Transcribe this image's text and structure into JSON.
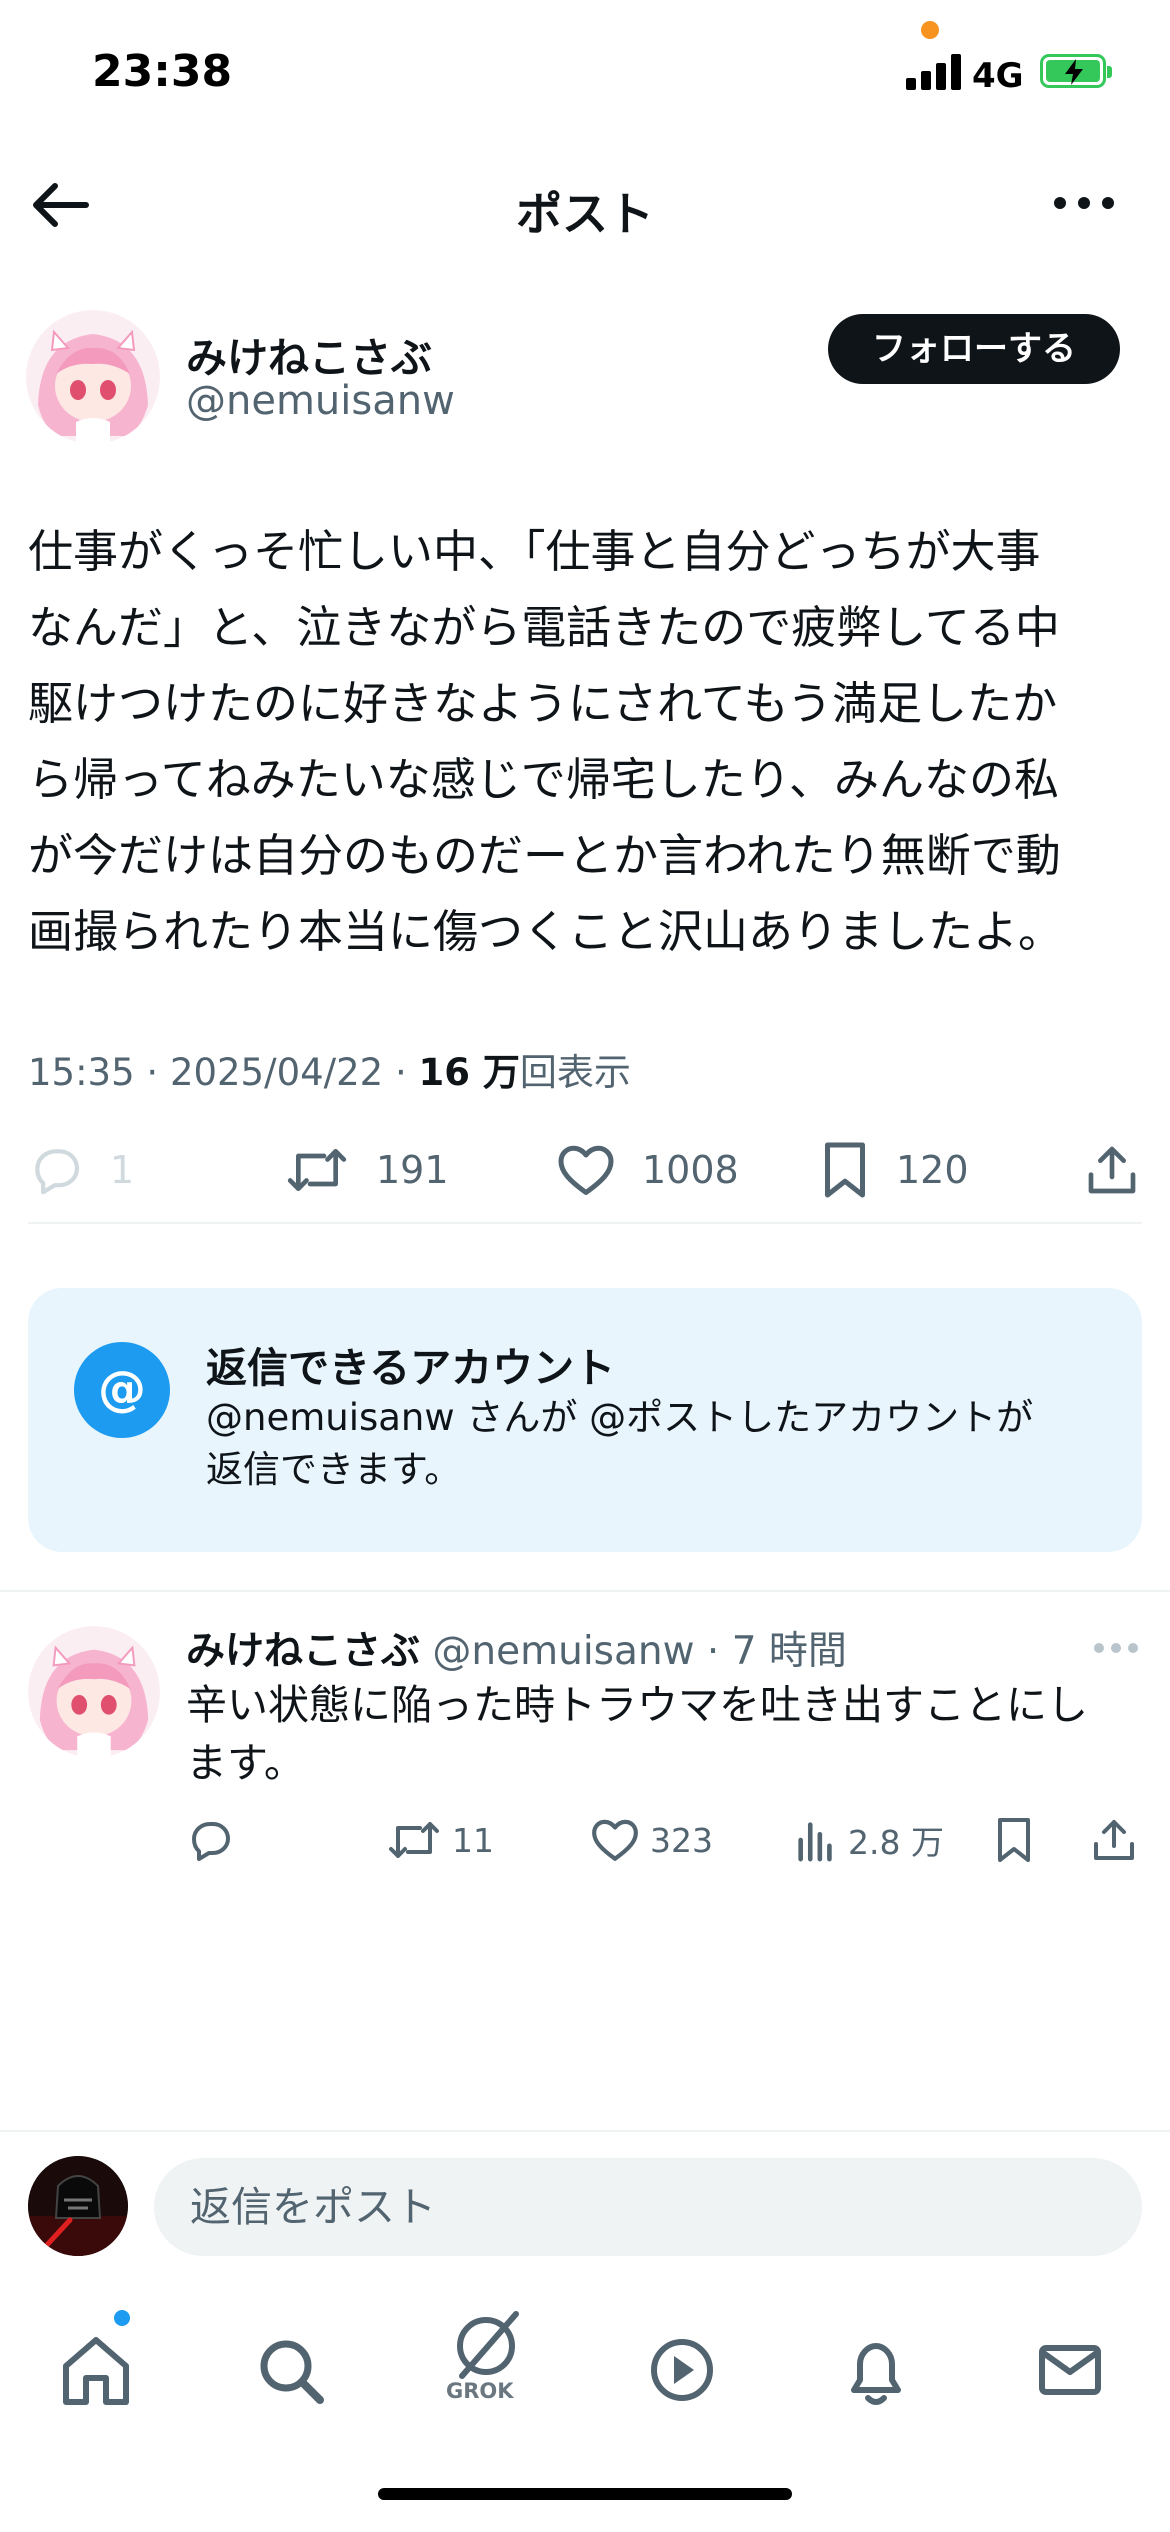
{
  "status_bar": {
    "time": "23:38",
    "network": "4G"
  },
  "header": {
    "title": "ポスト"
  },
  "post": {
    "author_name": "みけねこさぶ",
    "author_handle": "@nemuisanw",
    "follow_label": "フォローする",
    "body_lines": [
      "仕事がくっそ忙しい中、「仕事と自分どっちが大事",
      "なんだ」と、泣きながら電話きたので疲弊してる中",
      "駆けつけたのに好きなようにされてもう満足したか",
      "ら帰ってねみたいな感じで帰宅したり、みんなの私",
      "が今だけは自分のものだーとか言われたり無断で動",
      "画撮られたり本当に傷つくこと沢山ありましたよ。"
    ],
    "time": "15:35",
    "date": "2025/04/22",
    "views_count": "16 万",
    "views_label": "回表示",
    "replies": "1",
    "reposts": "191",
    "likes": "1008",
    "bookmarks": "120"
  },
  "reply_permissions": {
    "title": "返信できるアカウント",
    "text_line1": "@nemuisanw さんが @ポストしたアカウントが",
    "text_line2": "返信できます。",
    "icon_symbol": "@"
  },
  "reply": {
    "author_name": "みけねこさぶ",
    "author_handle": "@nemuisanw",
    "age": "7 時間",
    "text_line1": "辛い状態に陥った時トラウマを吐き出すことにし",
    "text_line2": "ます。",
    "reposts": "11",
    "likes": "323",
    "views": "2.8 万"
  },
  "compose": {
    "placeholder": "返信をポスト"
  },
  "bottom_nav": {
    "grok_label": "GROK"
  },
  "colors": {
    "accent": "#1d9bf0",
    "text": "#0f1419",
    "secondary": "#536471",
    "card_bg": "#e8f5fd"
  },
  "icons": [
    "back-arrow-icon",
    "more-icon",
    "reply-icon",
    "repost-icon",
    "like-icon",
    "bookmark-icon",
    "share-icon",
    "views-icon",
    "home-icon",
    "search-icon",
    "grok-icon",
    "video-icon",
    "bell-icon",
    "mail-icon"
  ]
}
